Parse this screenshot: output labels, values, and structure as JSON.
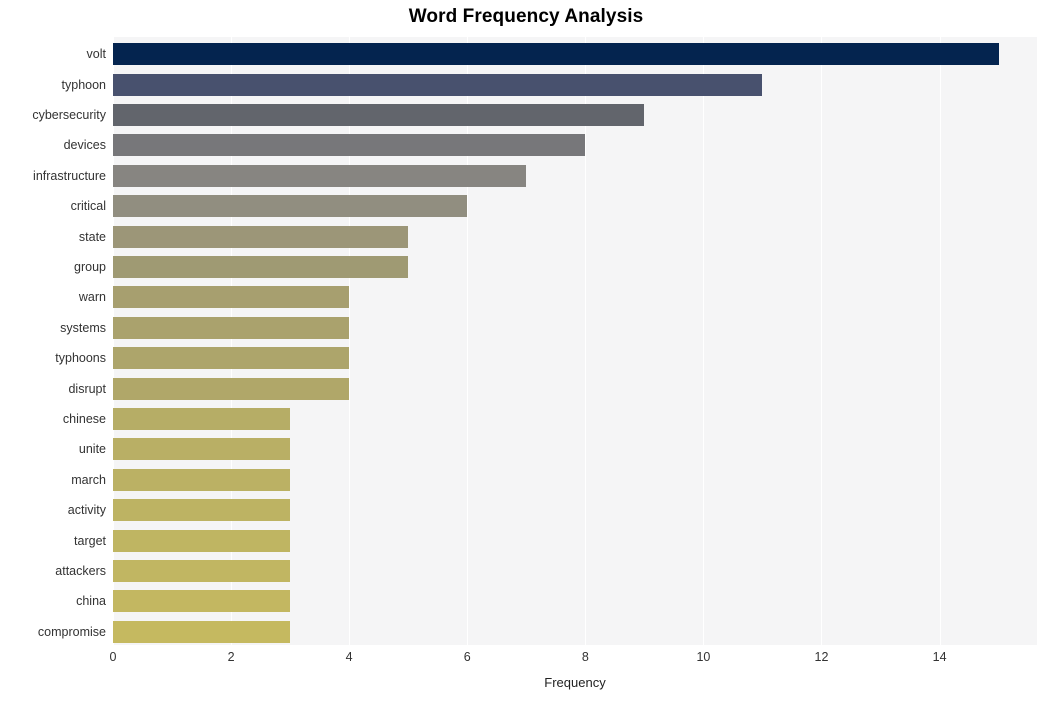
{
  "chart_data": {
    "type": "bar",
    "orientation": "horizontal",
    "title": "Word Frequency Analysis",
    "xlabel": "Frequency",
    "ylabel": "",
    "xlim": [
      0,
      15.65
    ],
    "xticks": [
      0,
      2,
      4,
      6,
      8,
      10,
      12,
      14
    ],
    "xtick_labels": [
      "0",
      "2",
      "4",
      "6",
      "8",
      "10",
      "12",
      "14"
    ],
    "grid": "vertical-only",
    "legend": "none",
    "categories": [
      "volt",
      "typhoon",
      "cybersecurity",
      "devices",
      "infrastructure",
      "critical",
      "state",
      "group",
      "warn",
      "systems",
      "typhoons",
      "disrupt",
      "chinese",
      "unite",
      "march",
      "activity",
      "target",
      "attackers",
      "china",
      "compromise"
    ],
    "values": [
      15,
      11,
      9,
      8,
      7,
      6,
      5,
      5,
      4,
      4,
      4,
      4,
      3,
      3,
      3,
      3,
      3,
      3,
      3,
      3
    ],
    "bar_colors": [
      "#04244f",
      "#48516e",
      "#62656c",
      "#77777a",
      "#878581",
      "#918e80",
      "#9c9678",
      "#9f9a73",
      "#a79f6f",
      "#aaa26d",
      "#ada56b",
      "#b0a769",
      "#b6ad66",
      "#b9af65",
      "#bbb164",
      "#bdb363",
      "#bfb562",
      "#c1b662",
      "#c3b761",
      "#c5b960"
    ]
  },
  "figure": {
    "background_color": "#ffffff",
    "plot_background_color": "#f5f5f6",
    "gridline_color": "#ffffff",
    "tick_label_color": "#333333",
    "title_color": "#000000"
  }
}
